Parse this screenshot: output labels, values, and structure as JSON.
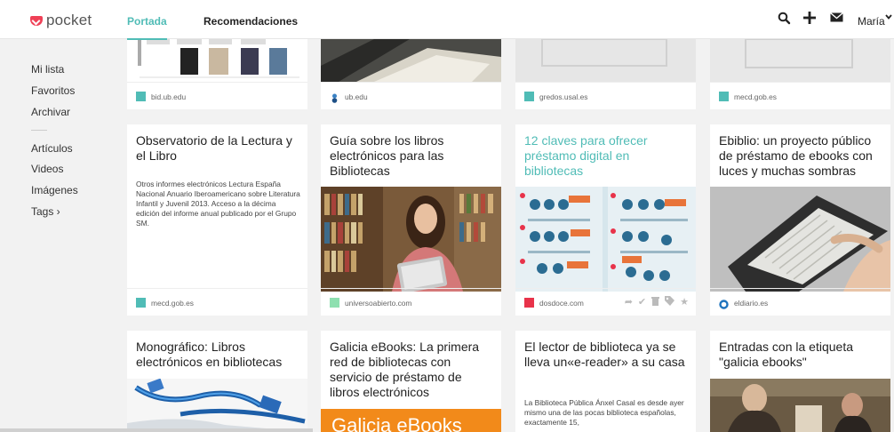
{
  "header": {
    "logo_text": "pocket",
    "tabs": [
      {
        "label": "Portada",
        "active": true
      },
      {
        "label": "Recomendaciones",
        "active": false
      }
    ],
    "icons": [
      "search-icon",
      "add-icon",
      "inbox-icon"
    ],
    "user_name": "María",
    "accent_color": "#50bcb6",
    "brand_color": "#ef4056"
  },
  "sidebar": {
    "items": [
      {
        "label": "Mi lista"
      },
      {
        "label": "Favoritos"
      },
      {
        "label": "Archivar"
      },
      {
        "label": "Artículos"
      },
      {
        "label": "Videos"
      },
      {
        "label": "Imágenes"
      },
      {
        "label": "Tags ›"
      }
    ]
  },
  "cards_row1": [
    {
      "domain": "bid.ub.edu",
      "favicon_color": "#50bcb6"
    },
    {
      "domain": "ub.edu",
      "favicon_color": "#3b82c4"
    },
    {
      "domain": "gredos.usal.es",
      "favicon_color": "#50bcb6"
    },
    {
      "domain": "mecd.gob.es",
      "favicon_color": "#50bcb6"
    }
  ],
  "cards_row2": [
    {
      "title": "Observatorio de la Lectura y el Libro",
      "excerpt": "Otros informes electrónicos Lectura España Nacional Anuario Iberoamericano sobre Literatura Infantil y Juvenil 2013. Acceso a la décima edición del informe anual publicado por el Grupo SM.",
      "domain": "mecd.gob.es",
      "favicon_color": "#50bcb6"
    },
    {
      "title": "Guía sobre los libros electrónicos para las Bibliotecas",
      "domain": "universoabierto.com",
      "favicon_color": "#8ee0b0"
    },
    {
      "title": "12 claves para ofrecer préstamo digital en bibliotecas",
      "domain": "dosdoce.com",
      "favicon_color": "#e8334a",
      "highlighted": true
    },
    {
      "title": "Ebiblio: un proyecto público de préstamo de ebooks con luces y muchas sombras",
      "domain": "eldiario.es",
      "favicon_color": "#1e73be"
    }
  ],
  "cards_row3": [
    {
      "title": "Monográfico: Libros electrónicos en bibliotecas"
    },
    {
      "title": "Galicia eBooks: La primera red de bibliotecas con servicio de préstamo de libros electrónicos",
      "image_text": "Galicia eBooks"
    },
    {
      "title": "El lector de biblioteca ya se lleva un«e-reader» a su casa",
      "excerpt": "La Biblioteca Pública Ánxel Casal es desde ayer mismo una de las pocas biblioteca españolas, exactamente 15,"
    },
    {
      "title": "Entradas con la etiqueta \"galicia ebooks\""
    }
  ]
}
